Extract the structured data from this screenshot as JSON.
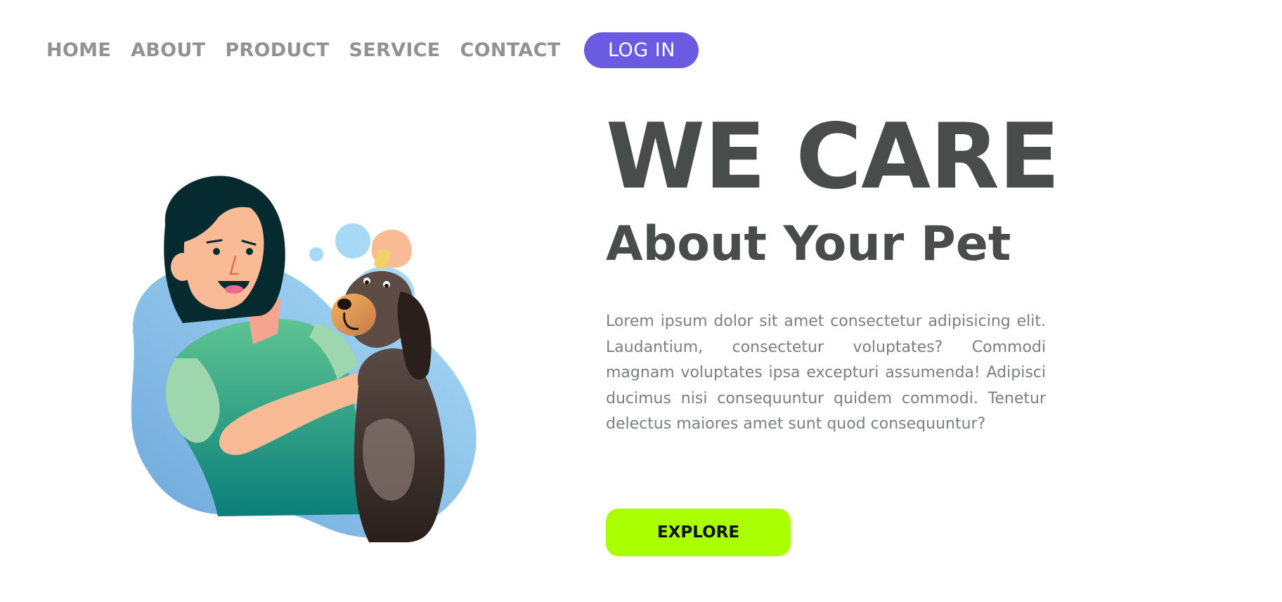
{
  "nav": {
    "items": [
      {
        "label": "HOME"
      },
      {
        "label": "ABOUT"
      },
      {
        "label": "PRODUCT"
      },
      {
        "label": "SERVICE"
      },
      {
        "label": "CONTACT"
      }
    ],
    "login_label": "LOG IN"
  },
  "hero": {
    "title": "WE CARE",
    "subtitle": "About Your Pet",
    "description": "Lorem ipsum dolor sit amet consectetur adipisicing elit. Laudantium, consectetur voluptates? Commodi magnam voluptates ipsa excepturi assumenda! Adipisci ducimus nisi consequuntur quidem commodi. Tenetur delectus maiores amet sunt quod consequuntur?",
    "explore_label": "EXPLORE"
  },
  "illustration": {
    "subject": "woman-giving-eye-drops-to-dog"
  },
  "colors": {
    "accent": "#6b5ae2",
    "explore": "#aaff00",
    "heading": "#4a4b4b",
    "nav_text": "#8f9394",
    "blob": "#8ec8ee"
  }
}
